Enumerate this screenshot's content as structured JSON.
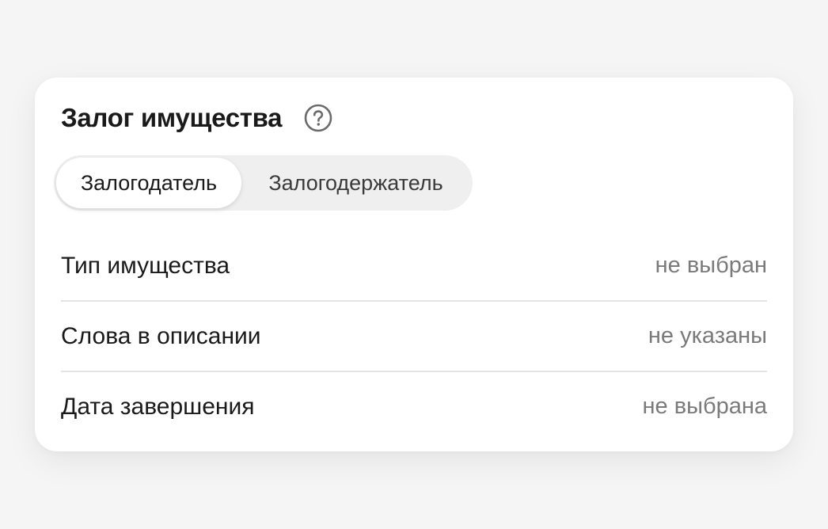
{
  "card": {
    "title": "Залог имущества",
    "help_icon": "question-circle-icon"
  },
  "segmented": {
    "options": [
      {
        "label": "Залогодатель",
        "selected": true
      },
      {
        "label": "Залогодержатель",
        "selected": false
      }
    ]
  },
  "filters": [
    {
      "label": "Тип имущества",
      "value": "не выбран"
    },
    {
      "label": "Слова в описании",
      "value": "не указаны"
    },
    {
      "label": "Дата завершения",
      "value": "не выбрана"
    }
  ],
  "colors": {
    "page_background": "#f5f5f5",
    "card_background": "#ffffff",
    "segment_track": "#efefef",
    "muted_text": "#7a7a7a",
    "divider": "#e3e3e3"
  }
}
